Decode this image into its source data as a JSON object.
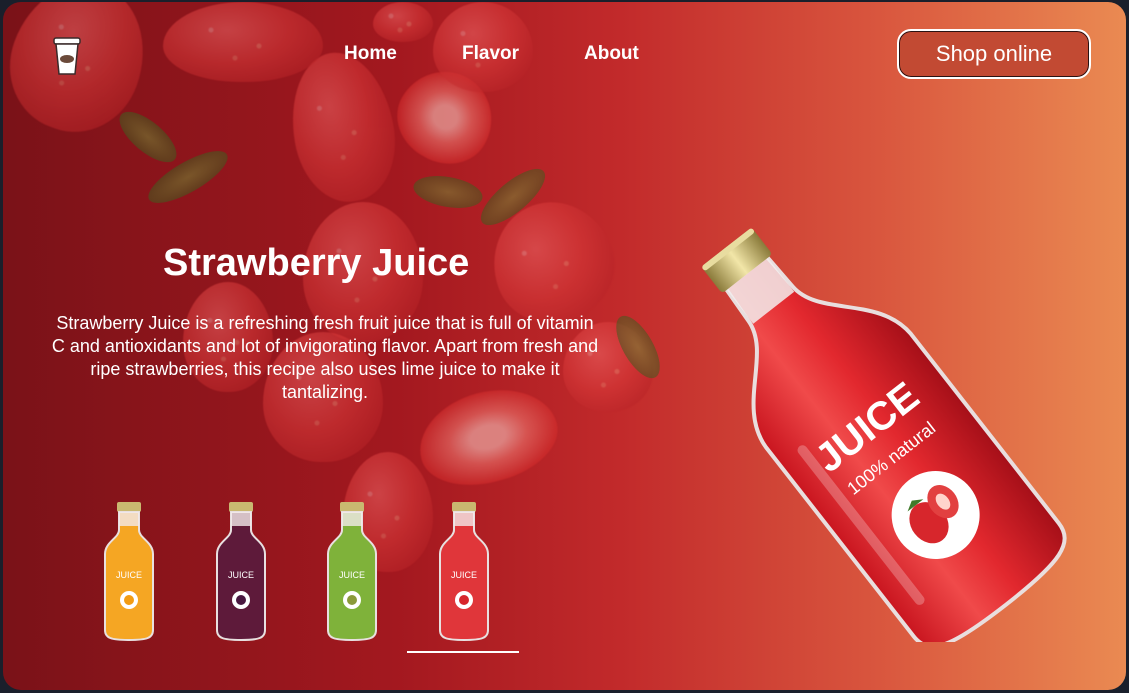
{
  "brand": {
    "logo_icon": "juice-cup-icon"
  },
  "nav": {
    "items": [
      {
        "label": "Home"
      },
      {
        "label": "Flavor"
      },
      {
        "label": "About"
      }
    ],
    "cta_label": "Shop online"
  },
  "hero": {
    "title": "Strawberry Juice",
    "description": "Strawberry Juice is a refreshing fresh fruit juice that is full of vitamin C and antioxidants and lot of invigorating flavor. Apart from fresh and ripe strawberries, this recipe also uses lime juice to make it tantalizing.",
    "bottle_label": "JUICE",
    "bottle_sublabel": "100% natural"
  },
  "thumbnails": [
    {
      "flavor": "orange",
      "color": "#f5a623",
      "label": "JUICE",
      "selected": false
    },
    {
      "flavor": "blackberry",
      "color": "#5e1a3a",
      "label": "JUICE",
      "selected": false
    },
    {
      "flavor": "kiwi",
      "color": "#7fb23a",
      "label": "JUICE",
      "selected": false
    },
    {
      "flavor": "strawberry",
      "color": "#e0363a",
      "label": "JUICE",
      "selected": true
    }
  ],
  "colors": {
    "background_start": "#7a1218",
    "background_end": "#ea8a52",
    "button_bg": "#c24a33",
    "text": "#ffffff"
  }
}
